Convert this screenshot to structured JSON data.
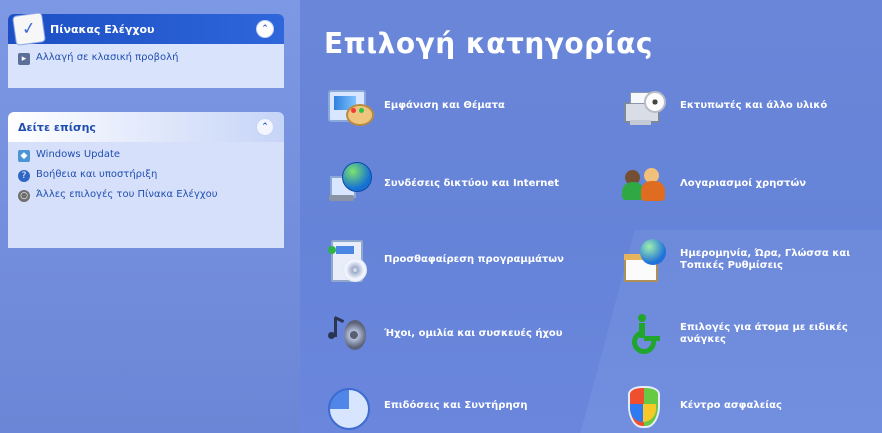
{
  "sidebar": {
    "control_panel": {
      "title": "Πίνακας Ελέγχου",
      "classic_view_link": "Αλλαγή σε κλασική προβολή"
    },
    "see_also": {
      "title": "Δείτε επίσης",
      "items": [
        {
          "label": "Windows Update",
          "icon": "windows-update-icon"
        },
        {
          "label": "Βοήθεια και υποστήριξη",
          "icon": "help-icon"
        },
        {
          "label": "Άλλες επιλογές του Πίνακα Ελέγχου",
          "icon": "gear-icon"
        }
      ]
    }
  },
  "main": {
    "title": "Επιλογή κατηγορίας",
    "categories": [
      {
        "label": "Εμφάνιση και Θέματα",
        "icon": "appearance-themes-icon"
      },
      {
        "label": "Συνδέσεις δικτύου και Internet",
        "icon": "network-internet-icon"
      },
      {
        "label": "Προσθαφαίρεση προγραμμάτων",
        "icon": "add-remove-programs-icon"
      },
      {
        "label": "Ήχοι, ομιλία και συσκευές ήχου",
        "icon": "sounds-speech-icon"
      },
      {
        "label": "Επιδόσεις και Συντήρηση",
        "icon": "performance-maintenance-icon"
      },
      {
        "label": "Εκτυπωτές και άλλο υλικό",
        "icon": "printers-hardware-icon"
      },
      {
        "label": "Λογαριασμοί χρηστών",
        "icon": "user-accounts-icon"
      },
      {
        "label": "Ημερομηνία, Ώρα, Γλώσσα και Τοπικές Ρυθμίσεις",
        "icon": "date-time-language-icon"
      },
      {
        "label": "Επιλογές για άτομα με ειδικές ανάγκες",
        "icon": "accessibility-icon"
      },
      {
        "label": "Κέντρο ασφαλείας",
        "icon": "security-center-icon"
      }
    ]
  }
}
